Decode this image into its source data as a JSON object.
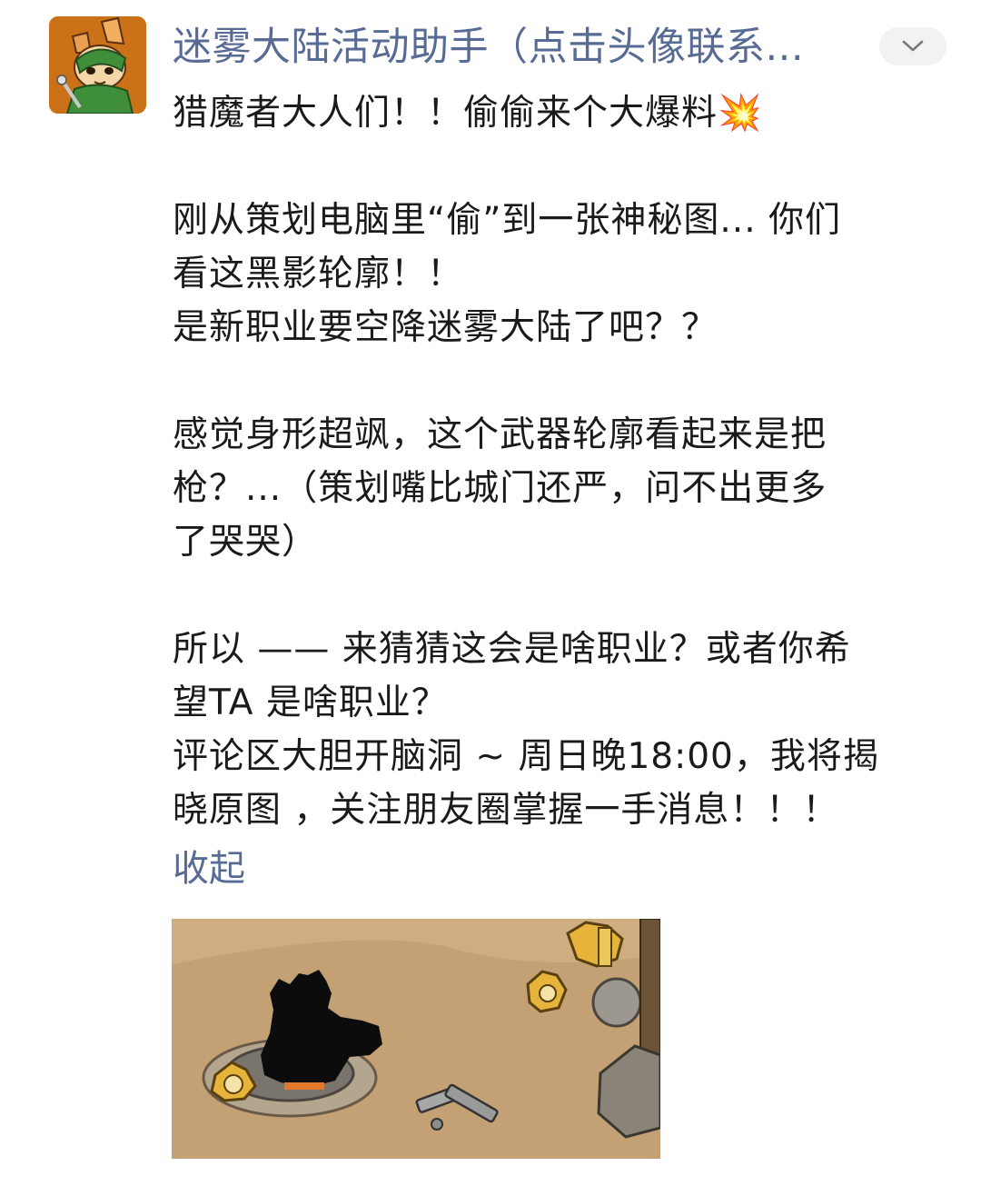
{
  "account": {
    "name": "迷雾大陆活动助手（点击头像联系..."
  },
  "post": {
    "lines": [
      "猎魔者大人们！！偷偷来个大爆料💥",
      "",
      "刚从策划电脑里“偷”到一张神秘图... 你们",
      "看这黑影轮廓！！",
      "是新职业要空降迷雾大陆了吧？？",
      "",
      "感觉身形超飒，这个武器轮廓看起来是把",
      "枪？...（策划嘴比城门还严，问不出更多",
      "了哭哭）",
      "",
      "所以 —— 来猜猜这会是啥职业？或者你希",
      "望TA 是啥职业？",
      "评论区大胆开脑洞 ~ 周日晚18:00，我将揭",
      "晓原图 ，关注朋友圈掌握一手消息！！！"
    ],
    "collapse_label": "收起"
  },
  "icons": {
    "more": "chevron-down-icon",
    "avatar": "fox-character-avatar"
  },
  "colors": {
    "link": "#576b95",
    "text": "#1a1a1a",
    "button_bg": "#f2f2f2"
  }
}
